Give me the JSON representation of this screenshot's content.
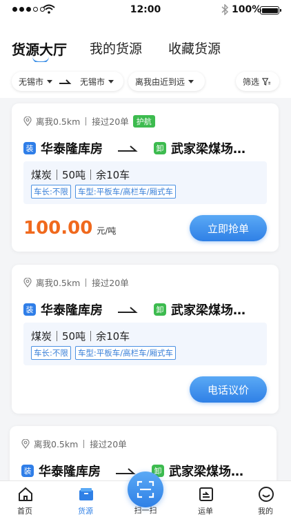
{
  "status_bar": {
    "time": "12:00",
    "battery_percent": "100%"
  },
  "tabs": [
    {
      "label": "货源大厅",
      "active": true
    },
    {
      "label": "我的货源",
      "active": false
    },
    {
      "label": "收藏货源",
      "active": false
    }
  ],
  "filters": {
    "from_city": "无锡市",
    "to_city": "无锡市",
    "sort": "离我由近到远",
    "filter_label": "筛选"
  },
  "cards": [
    {
      "distance": "离我0.5km",
      "orders": "接过20单",
      "badge": "护航",
      "load_tag": "装",
      "origin": "华泰隆库房",
      "unload_tag": "卸",
      "destination": "武家梁煤场…",
      "goods": "煤炭｜50吨｜余10车",
      "length_chip": "车长:不限",
      "type_chip": "车型:平板车/高栏车/厢式车",
      "price": "100.00",
      "price_unit": "元/吨",
      "action": "立即抢单"
    },
    {
      "distance": "离我0.5km",
      "orders": "接过20单",
      "load_tag": "装",
      "origin": "华泰隆库房",
      "unload_tag": "卸",
      "destination": "武家梁煤场…",
      "goods": "煤炭｜50吨｜余10车",
      "length_chip": "车长:不限",
      "type_chip": "车型:平板车/高栏车/厢式车",
      "action": "电话议价"
    },
    {
      "distance": "离我0.5km",
      "orders": "接过20单",
      "load_tag": "装",
      "origin": "华泰隆库房",
      "unload_tag": "卸",
      "destination": "武家梁煤场…"
    }
  ],
  "bottom_nav": {
    "home": "首页",
    "cargo": "货源",
    "scan": "扫一扫",
    "waybill": "运单",
    "mine": "我的"
  },
  "colors": {
    "primary": "#2f80e6",
    "price": "#f0691d",
    "green": "#3dbb4f"
  }
}
